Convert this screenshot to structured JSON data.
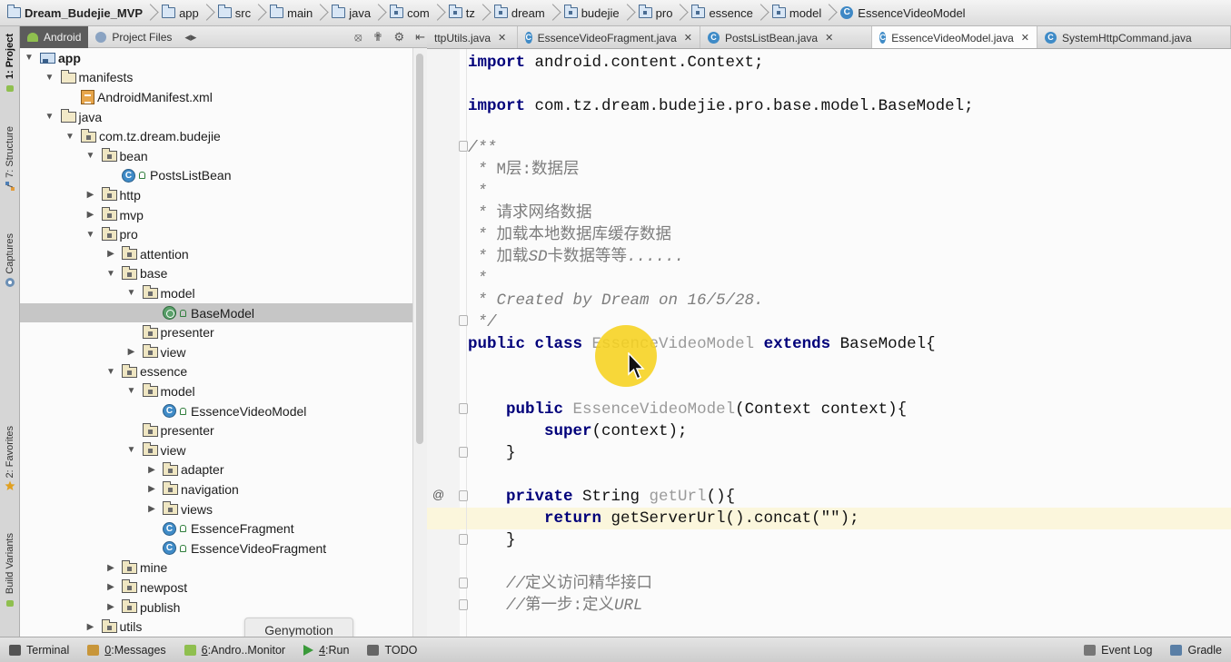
{
  "breadcrumbs": [
    "Dream_Budejie_MVP",
    "app",
    "src",
    "main",
    "java",
    "com",
    "tz",
    "dream",
    "budejie",
    "pro",
    "essence",
    "model",
    "EssenceVideoModel"
  ],
  "left_stripe": {
    "tabs": [
      "1: Project",
      "7: Structure",
      "Captures",
      "2: Favorites",
      "Build Variants"
    ]
  },
  "project_panel": {
    "tabs": [
      "Android",
      "Project Files"
    ]
  },
  "tree": [
    {
      "label": "app",
      "indent": 0,
      "arrow": "open",
      "icon": "module",
      "bold": true
    },
    {
      "label": "manifests",
      "indent": 1,
      "arrow": "open",
      "icon": "folder"
    },
    {
      "label": "AndroidManifest.xml",
      "indent": 2,
      "arrow": "none",
      "icon": "xml"
    },
    {
      "label": "java",
      "indent": 1,
      "arrow": "open",
      "icon": "folder"
    },
    {
      "label": "com.tz.dream.budejie",
      "indent": 2,
      "arrow": "open",
      "icon": "pkg"
    },
    {
      "label": "bean",
      "indent": 3,
      "arrow": "open",
      "icon": "pkg"
    },
    {
      "label": "PostsListBean",
      "indent": 4,
      "arrow": "none",
      "icon": "class"
    },
    {
      "label": "http",
      "indent": 3,
      "arrow": "closed",
      "icon": "pkg"
    },
    {
      "label": "mvp",
      "indent": 3,
      "arrow": "closed",
      "icon": "pkg"
    },
    {
      "label": "pro",
      "indent": 3,
      "arrow": "open",
      "icon": "pkg"
    },
    {
      "label": "attention",
      "indent": 4,
      "arrow": "closed",
      "icon": "pkg"
    },
    {
      "label": "base",
      "indent": 4,
      "arrow": "open",
      "icon": "pkg"
    },
    {
      "label": "model",
      "indent": 5,
      "arrow": "open",
      "icon": "pkg"
    },
    {
      "label": "BaseModel",
      "indent": 6,
      "arrow": "none",
      "icon": "abstract",
      "selected": true
    },
    {
      "label": "presenter",
      "indent": 5,
      "arrow": "none",
      "icon": "pkg"
    },
    {
      "label": "view",
      "indent": 5,
      "arrow": "closed",
      "icon": "pkg"
    },
    {
      "label": "essence",
      "indent": 4,
      "arrow": "open",
      "icon": "pkg"
    },
    {
      "label": "model",
      "indent": 5,
      "arrow": "open",
      "icon": "pkg"
    },
    {
      "label": "EssenceVideoModel",
      "indent": 6,
      "arrow": "none",
      "icon": "class"
    },
    {
      "label": "presenter",
      "indent": 5,
      "arrow": "none",
      "icon": "pkg"
    },
    {
      "label": "view",
      "indent": 5,
      "arrow": "open",
      "icon": "pkg"
    },
    {
      "label": "adapter",
      "indent": 6,
      "arrow": "closed",
      "icon": "pkg"
    },
    {
      "label": "navigation",
      "indent": 6,
      "arrow": "closed",
      "icon": "pkg"
    },
    {
      "label": "views",
      "indent": 6,
      "arrow": "closed",
      "icon": "pkg"
    },
    {
      "label": "EssenceFragment",
      "indent": 6,
      "arrow": "none",
      "icon": "class"
    },
    {
      "label": "EssenceVideoFragment",
      "indent": 6,
      "arrow": "none",
      "icon": "class"
    },
    {
      "label": "mine",
      "indent": 4,
      "arrow": "closed",
      "icon": "pkg"
    },
    {
      "label": "newpost",
      "indent": 4,
      "arrow": "closed",
      "icon": "pkg"
    },
    {
      "label": "publish",
      "indent": 4,
      "arrow": "closed",
      "icon": "pkg"
    },
    {
      "label": "utils",
      "indent": 3,
      "arrow": "closed",
      "icon": "pkg"
    }
  ],
  "editor_tabs": [
    {
      "label": "ttpUtils.java",
      "active": false
    },
    {
      "label": "EssenceVideoFragment.java",
      "active": false
    },
    {
      "label": "PostsListBean.java",
      "active": false
    },
    {
      "label": "EssenceVideoModel.java",
      "active": true
    },
    {
      "label": "SystemHttpCommand.java",
      "active": false
    }
  ],
  "code_lines": [
    [
      "kw|import",
      "t| android.content.Context;"
    ],
    [],
    [
      "kw|import",
      "t| com.tz.dream.budejie.pro.base.model.BaseModel;"
    ],
    [],
    [
      "cm|/**"
    ],
    [
      "cm| * ",
      "cmz|M层:数据层"
    ],
    [
      "cm| *"
    ],
    [
      "cm| * ",
      "cmz|请求网络数据"
    ],
    [
      "cm| * ",
      "cmz|加载本地数据库缓存数据"
    ],
    [
      "cm| * ",
      "cmz|加载",
      "cm|SD",
      "cmz|卡数据等等",
      "cm|......"
    ],
    [
      "cm| *"
    ],
    [
      "cm| * Created by Dream on 16/5/28."
    ],
    [
      "cm| */"
    ],
    [
      "kw|public class",
      "t| ",
      "gray|EssenceVideoModel",
      "t| ",
      "kw|extends",
      "t| BaseModel{"
    ],
    [],
    [],
    [
      "t|    ",
      "kw|public",
      "t| ",
      "gray|EssenceVideoModel",
      "t|(Context context){"
    ],
    [
      "t|        ",
      "kw|super",
      "t|(context);"
    ],
    [
      "t|    }"
    ],
    [],
    [
      "t|    ",
      "kw|private",
      "t| String ",
      "method|getUrl",
      "t|(){"
    ],
    [
      "t|        ",
      "kw|return",
      "t| getServerUrl().concat(\"\");"
    ],
    [
      "t|    }"
    ],
    [],
    [
      "cm|    //",
      "cmz|定义访问精华接口"
    ],
    [
      "cm|    //",
      "cmz|第一步:定义",
      "cm|URL"
    ]
  ],
  "bottom_tools": [
    {
      "label": "Terminal",
      "mnemonic": ""
    },
    {
      "label": "Messages",
      "mnemonic": "0"
    },
    {
      "label": "Andro..Monitor",
      "mnemonic": "6"
    },
    {
      "label": "Run",
      "mnemonic": "4"
    },
    {
      "label": "TODO",
      "mnemonic": ""
    },
    {
      "label": "Event Log",
      "mnemonic": ""
    },
    {
      "label": "Gradle",
      "mnemonic": ""
    }
  ],
  "tooltip": "Genymotion",
  "colors": {
    "keyword": "#00007a",
    "comment": "#7d7d7d",
    "selection": "#c6c6c6",
    "cursor_highlight": "#f6d21e"
  }
}
